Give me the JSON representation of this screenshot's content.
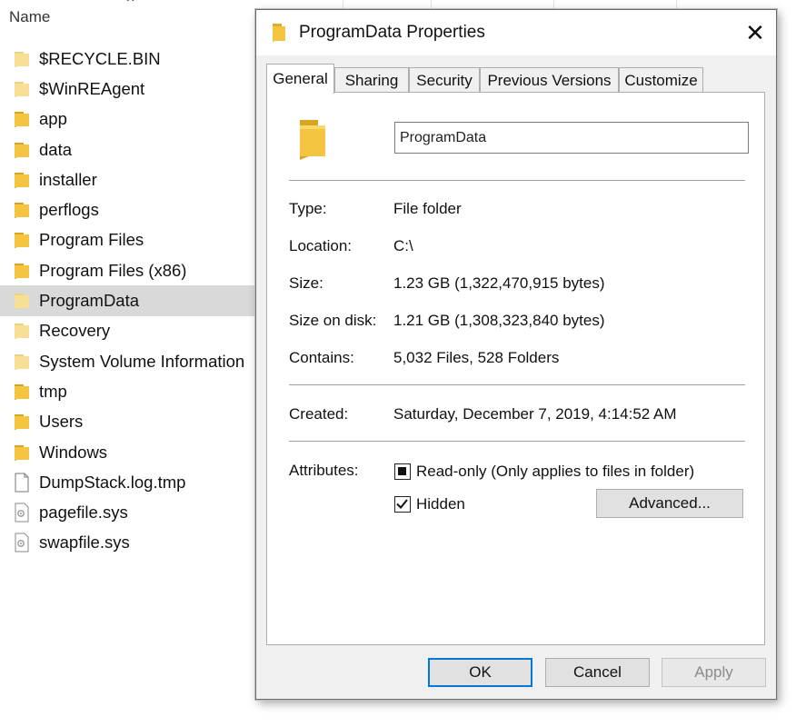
{
  "explorer": {
    "column_header": "Name",
    "files": [
      {
        "name": "$RECYCLE.BIN",
        "type": "folder",
        "faded": true
      },
      {
        "name": "$WinREAgent",
        "type": "folder",
        "faded": true
      },
      {
        "name": "app",
        "type": "folder"
      },
      {
        "name": "data",
        "type": "folder"
      },
      {
        "name": "installer",
        "type": "folder"
      },
      {
        "name": "perflogs",
        "type": "folder"
      },
      {
        "name": "Program Files",
        "type": "folder"
      },
      {
        "name": "Program Files (x86)",
        "type": "folder"
      },
      {
        "name": "ProgramData",
        "type": "folder",
        "selected": true,
        "faded": true
      },
      {
        "name": "Recovery",
        "type": "folder",
        "faded": true
      },
      {
        "name": "System Volume Information",
        "type": "folder",
        "faded": true
      },
      {
        "name": "tmp",
        "type": "folder"
      },
      {
        "name": "Users",
        "type": "folder"
      },
      {
        "name": "Windows",
        "type": "folder"
      },
      {
        "name": "DumpStack.log.tmp",
        "type": "file"
      },
      {
        "name": "pagefile.sys",
        "type": "system-file"
      },
      {
        "name": "swapfile.sys",
        "type": "system-file"
      }
    ]
  },
  "dialog": {
    "title": "ProgramData Properties",
    "close_symbol": "✕",
    "tabs": [
      "General",
      "Sharing",
      "Security",
      "Previous Versions",
      "Customize"
    ],
    "active_tab": "General",
    "name_value": "ProgramData",
    "properties": {
      "type_label": "Type:",
      "type_value": "File folder",
      "location_label": "Location:",
      "location_value": "C:\\",
      "size_label": "Size:",
      "size_value": "1.23 GB (1,322,470,915 bytes)",
      "size_on_disk_label": "Size on disk:",
      "size_on_disk_value": "1.21 GB (1,308,323,840 bytes)",
      "contains_label": "Contains:",
      "contains_value": "5,032 Files, 528 Folders",
      "created_label": "Created:",
      "created_value": "Saturday, December 7, 2019, 4:14:52 AM"
    },
    "attributes": {
      "label": "Attributes:",
      "readonly_label": "Read-only (Only applies to files in folder)",
      "readonly_state": "indeterminate",
      "hidden_label": "Hidden",
      "hidden_state": "checked",
      "advanced_button": "Advanced..."
    },
    "buttons": {
      "ok": "OK",
      "cancel": "Cancel",
      "apply": "Apply"
    }
  },
  "colors": {
    "folder": "#f5c542",
    "folder_faded": "#f8df96",
    "selection": "#d9d9d9",
    "focus_border": "#0078d7",
    "dialog_bg": "#f0f0f0"
  }
}
